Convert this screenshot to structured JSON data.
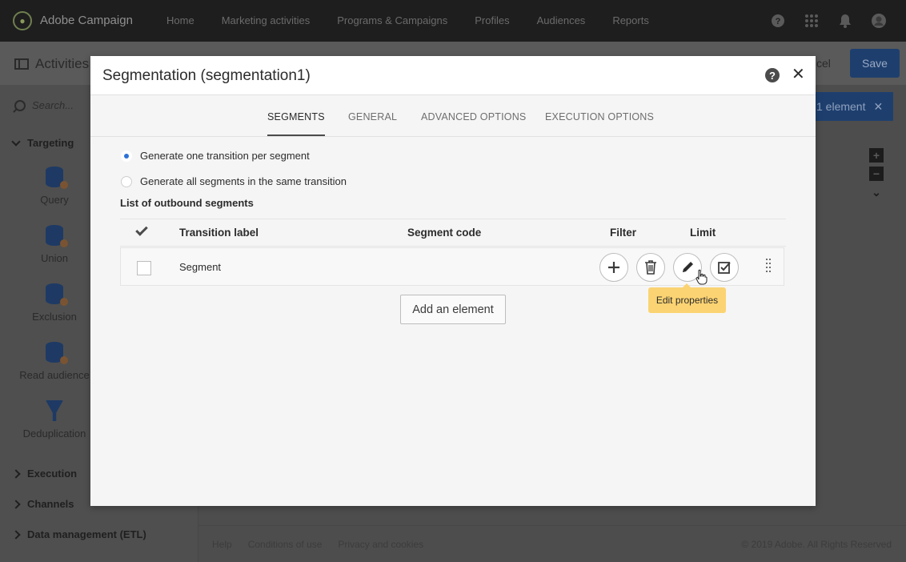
{
  "app": {
    "name": "Adobe Campaign",
    "nav": [
      "Home",
      "Marketing activities",
      "Programs & Campaigns",
      "Profiles",
      "Audiences",
      "Reports"
    ]
  },
  "page": {
    "title": "Activities",
    "cancel_label": "cel",
    "save_label": "Save",
    "filter_chip": "1 element",
    "search_placeholder": "Search..."
  },
  "sidebar": {
    "targeting_label": "Targeting",
    "tools": [
      "Query",
      "Union",
      "Exclusion",
      "Read audience",
      "Deduplication"
    ],
    "sections": [
      "Execution",
      "Channels",
      "Data management (ETL)"
    ]
  },
  "footer": {
    "links": [
      "Help",
      "Conditions of use",
      "Privacy and cookies"
    ],
    "copyright": "© 2019 Adobe. All Rights Reserved"
  },
  "modal": {
    "title": "Segmentation (segmentation1)",
    "tabs": [
      "SEGMENTS",
      "GENERAL",
      "ADVANCED OPTIONS",
      "EXECUTION OPTIONS"
    ],
    "active_tab": "SEGMENTS",
    "radio_options": [
      "Generate one transition per segment",
      "Generate all segments in the same transition"
    ],
    "selected_radio": "Generate one transition per segment",
    "list_label": "List of outbound segments",
    "columns": [
      "Transition label",
      "Segment code",
      "Filter",
      "Limit"
    ],
    "rows": [
      {
        "label": "Segment",
        "code": ""
      }
    ],
    "tooltip": "Edit properties",
    "add_button": "Add an element"
  },
  "colors": {
    "primary": "#2d71d6",
    "tooltip": "#fbd372",
    "topbar": "#1e1e1e"
  }
}
